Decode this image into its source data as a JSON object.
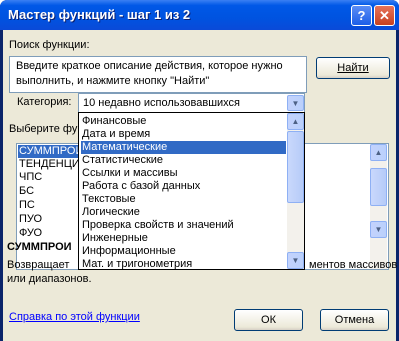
{
  "window": {
    "title": "Мастер функций - шаг 1 из 2",
    "help_glyph": "?",
    "close_glyph": "✕"
  },
  "search": {
    "label": "Поиск функции:",
    "field_value_line1": "Введите краткое описание действия, которое нужно",
    "field_value_line2": "выполнить, и нажмите кнопку \"Найти\"",
    "find_button": "Найти"
  },
  "category": {
    "label": "Категория:",
    "selected": "10 недавно использовавшихся",
    "options": [
      "Финансовые",
      "Дата и время",
      "Математические",
      "Статистические",
      "Ссылки и массивы",
      "Работа с базой данных",
      "Текстовые",
      "Логические",
      "Проверка свойств и значений",
      "Инженерные",
      "Информационные",
      "Мат. и тригонометрия"
    ],
    "highlighted_index": 2
  },
  "functions": {
    "label": "Выберите фун",
    "items": [
      "СУММПРОИ",
      "ТЕНДЕНЦИ",
      "ЧПС",
      "БС",
      "ПС",
      "ПУО",
      "ФУО"
    ],
    "selected_index": 0,
    "signature": "СУММПРОИ",
    "description_line1": "Возвращает",
    "description_line1_tail": "ментов массивов",
    "description_line2": "или диапазонов."
  },
  "footer": {
    "help_link": "Справка по этой функции",
    "ok_button": "ОК",
    "cancel_button": "Отмена"
  },
  "colors": {
    "title_bar": "#0058e7",
    "dialog_face": "#ece9d8",
    "selection": "#316ac5",
    "link": "#0000ff"
  }
}
